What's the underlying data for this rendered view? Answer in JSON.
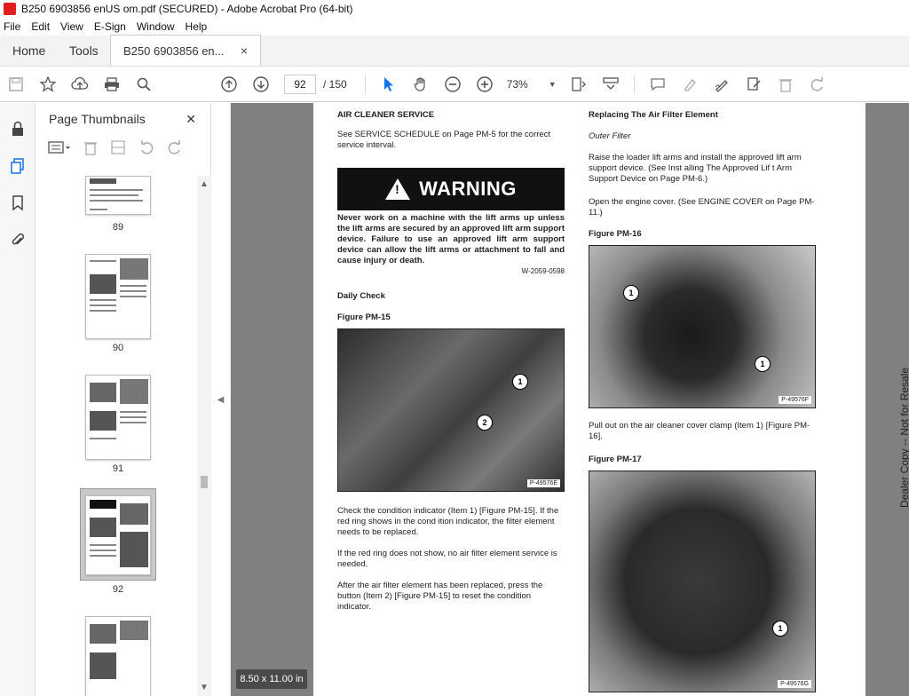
{
  "window": {
    "title": "B250 6903856 enUS om.pdf (SECURED) - Adobe Acrobat Pro (64-bit)"
  },
  "menu": [
    "File",
    "Edit",
    "View",
    "E-Sign",
    "Window",
    "Help"
  ],
  "tabs": {
    "home": "Home",
    "tools": "Tools",
    "doc": "B250 6903856 en...",
    "close": "×"
  },
  "toolbar": {
    "page_current": "92",
    "page_total": "/ 150",
    "zoom": "73%"
  },
  "panel": {
    "title": "Page Thumbnails",
    "close": "✕",
    "thumbs": [
      {
        "num": "89"
      },
      {
        "num": "90"
      },
      {
        "num": "91"
      },
      {
        "num": "92"
      }
    ]
  },
  "page": {
    "left": {
      "heading": "AIR CLEANER SERVICE",
      "intro": "See SERVICE SCHEDULE on Page PM-5 for the correct service interval.",
      "warning_title": "WARNING",
      "warning_text": "Never work on a machine with the lift arms up unless the lift arms are secured by an approved lift arm support device. Failure to use an approved lift arm support device can allow the lift arms or attachment to fall and cause injury or death.",
      "warning_code": "W-2059-0598",
      "daily_check": "Daily Check",
      "fig15": "Figure PM-15",
      "fig15_code": "P-49576E",
      "para1": "Check the condition indicator (Item 1)  [Figure PM-15].  If the  red ring shows in the cond    ition indicator, the filter element needs to be replaced.",
      "para2": "If the red ring does not show, no air filter element service is needed.",
      "para3": "After the air filter element has been replaced, press the button  (Item 2)  [Figure PM-15]  to reset the condition indicator."
    },
    "right": {
      "heading": "Replacing The Air Filter Element",
      "sub": "Outer Filter",
      "para1": "Raise the loader lift arms and install the approved lift arm support device. (See Inst alling The Approved Lif t Arm Support Device on Page PM-6.)",
      "para2": "Open the engine cover. (See ENGINE COVER on Page PM-11.)",
      "fig16": "Figure PM-16",
      "fig16_code": "P-49576F",
      "para3": "Pull out on the air cleaner cover clamp (Item 1)   [Figure PM-16].",
      "fig17": "Figure PM-17",
      "fig17_code": "P-49576G"
    },
    "side_note": "Dealer Copy -- Not for Resale"
  },
  "callouts": {
    "one": "1",
    "two": "2"
  },
  "page_size": "8.50 x 11.00 in"
}
